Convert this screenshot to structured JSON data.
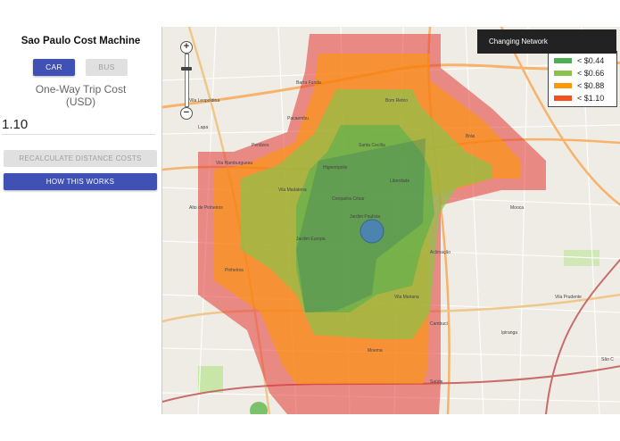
{
  "sidebar": {
    "title": "Sao Paulo Cost Machine",
    "modes": {
      "car": "CAR",
      "bus": "BUS",
      "active": "car"
    },
    "cost_label_line1": "One-Way Trip Cost",
    "cost_label_line2": "(USD)",
    "cost_value": "1.10",
    "recalculate_label": "RECALCULATE DISTANCE COSTS",
    "how_label": "HOW THIS WORKS"
  },
  "map": {
    "toast": "Changing Network",
    "zoom_in": "+",
    "zoom_out": "−",
    "legend": [
      {
        "label": "< $0.44",
        "color": "#4caf50"
      },
      {
        "label": "< $0.66",
        "color": "#8bc34a"
      },
      {
        "label": "< $0.88",
        "color": "#ff9800"
      },
      {
        "label": "< $1.10",
        "color": "#f4511e"
      }
    ],
    "labels": [
      "Santa Cecília",
      "Higienópolis",
      "Pacaembu",
      "Vila Madalena",
      "Jardim Paulista",
      "Jardim Europa",
      "Cerqueira César",
      "Liberdade",
      "Aclimação",
      "Moema",
      "Vila Mariana",
      "Pinheiros",
      "Lapa",
      "Barra Funda",
      "Bom Retiro",
      "Brás",
      "Mooca",
      "Cambuci",
      "Ipiranga",
      "Saúde",
      "Vila Prudente",
      "São C",
      "Alto de Pinheiros",
      "Vila Leopoldina",
      "Vila Hamburguesa",
      "Perdizes"
    ]
  }
}
